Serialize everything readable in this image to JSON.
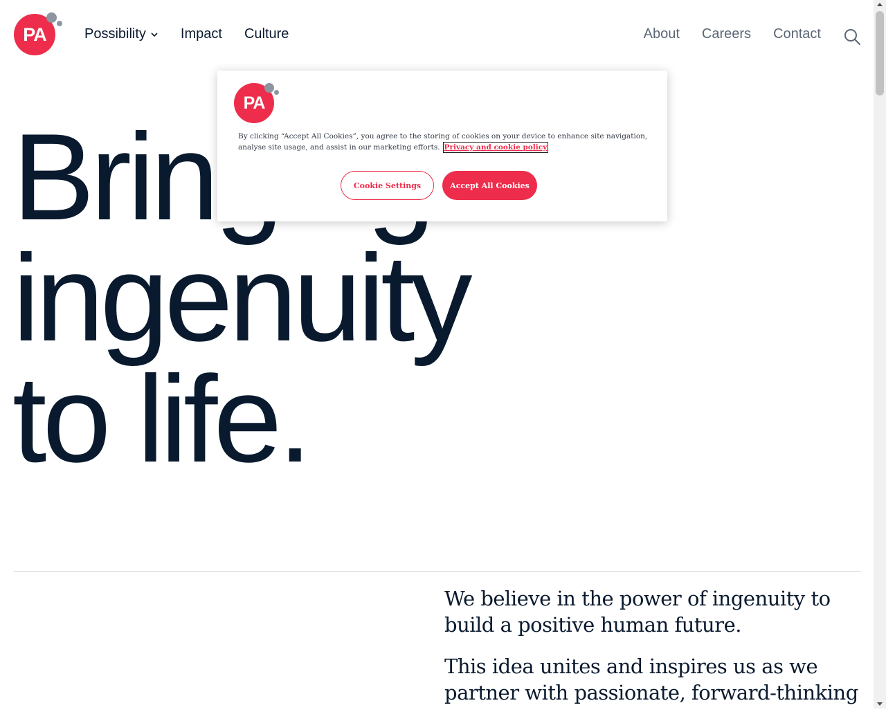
{
  "brand": {
    "logo_text": "PA",
    "accent": "#ee2c4b",
    "dot_color": "#8d95a1",
    "ink": "#0a1a2e"
  },
  "nav": {
    "left": [
      {
        "label": "Possibility",
        "has_dropdown": true
      },
      {
        "label": "Impact"
      },
      {
        "label": "Culture"
      }
    ],
    "right": [
      {
        "label": "About"
      },
      {
        "label": "Careers"
      },
      {
        "label": "Contact"
      }
    ],
    "search_icon": "search-icon"
  },
  "hero": {
    "line1": "Bringing",
    "line2": "ingenuity",
    "line3": "to life."
  },
  "intro": {
    "p1": "We believe in the power of ingenuity to build a positive human future.",
    "p2": "This idea unites and inspires us as we partner with passionate, forward-thinking"
  },
  "cookie_banner": {
    "logo_text": "PA",
    "message": "By clicking “Accept All Cookies”, you agree to the storing of cookies on your device to enhance site navigation, analyse site usage, and assist in our marketing efforts.",
    "policy_link": "Privacy and cookie policy",
    "settings_button": "Cookie Settings",
    "accept_button": "Accept All Cookies"
  }
}
